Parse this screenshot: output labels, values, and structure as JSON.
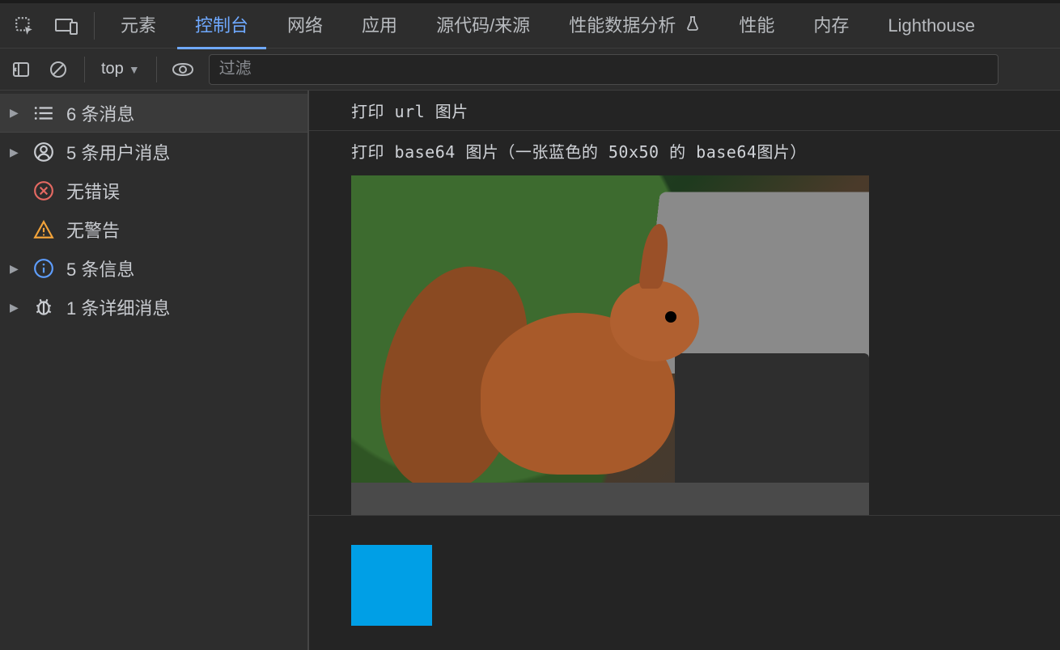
{
  "tabs": {
    "elements": "元素",
    "console": "控制台",
    "network": "网络",
    "application": "应用",
    "sources": "源代码/来源",
    "performance_insights": "性能数据分析",
    "performance": "性能",
    "memory": "内存",
    "lighthouse": "Lighthouse"
  },
  "toolbar": {
    "context_label": "top",
    "filter_placeholder": "过滤"
  },
  "sidebar": {
    "items": [
      {
        "id": "messages",
        "label": "6 条消息",
        "icon": "list",
        "expandable": true
      },
      {
        "id": "user",
        "label": "5 条用户消息",
        "icon": "user",
        "expandable": true
      },
      {
        "id": "errors",
        "label": "无错误",
        "icon": "error",
        "expandable": false
      },
      {
        "id": "warnings",
        "label": "无警告",
        "icon": "warning",
        "expandable": false
      },
      {
        "id": "info",
        "label": "5 条信息",
        "icon": "info",
        "expandable": true
      },
      {
        "id": "verbose",
        "label": "1 条详细消息",
        "icon": "bug",
        "expandable": true
      }
    ]
  },
  "log": {
    "line1": "打印 url 图片",
    "line2": "打印 base64 图片（一张蓝色的 50x50 的 base64图片）",
    "url_image_alt": "squirrel-image",
    "base64_swatch_color": "#009fe6",
    "base64_swatch_size_px": 100
  }
}
